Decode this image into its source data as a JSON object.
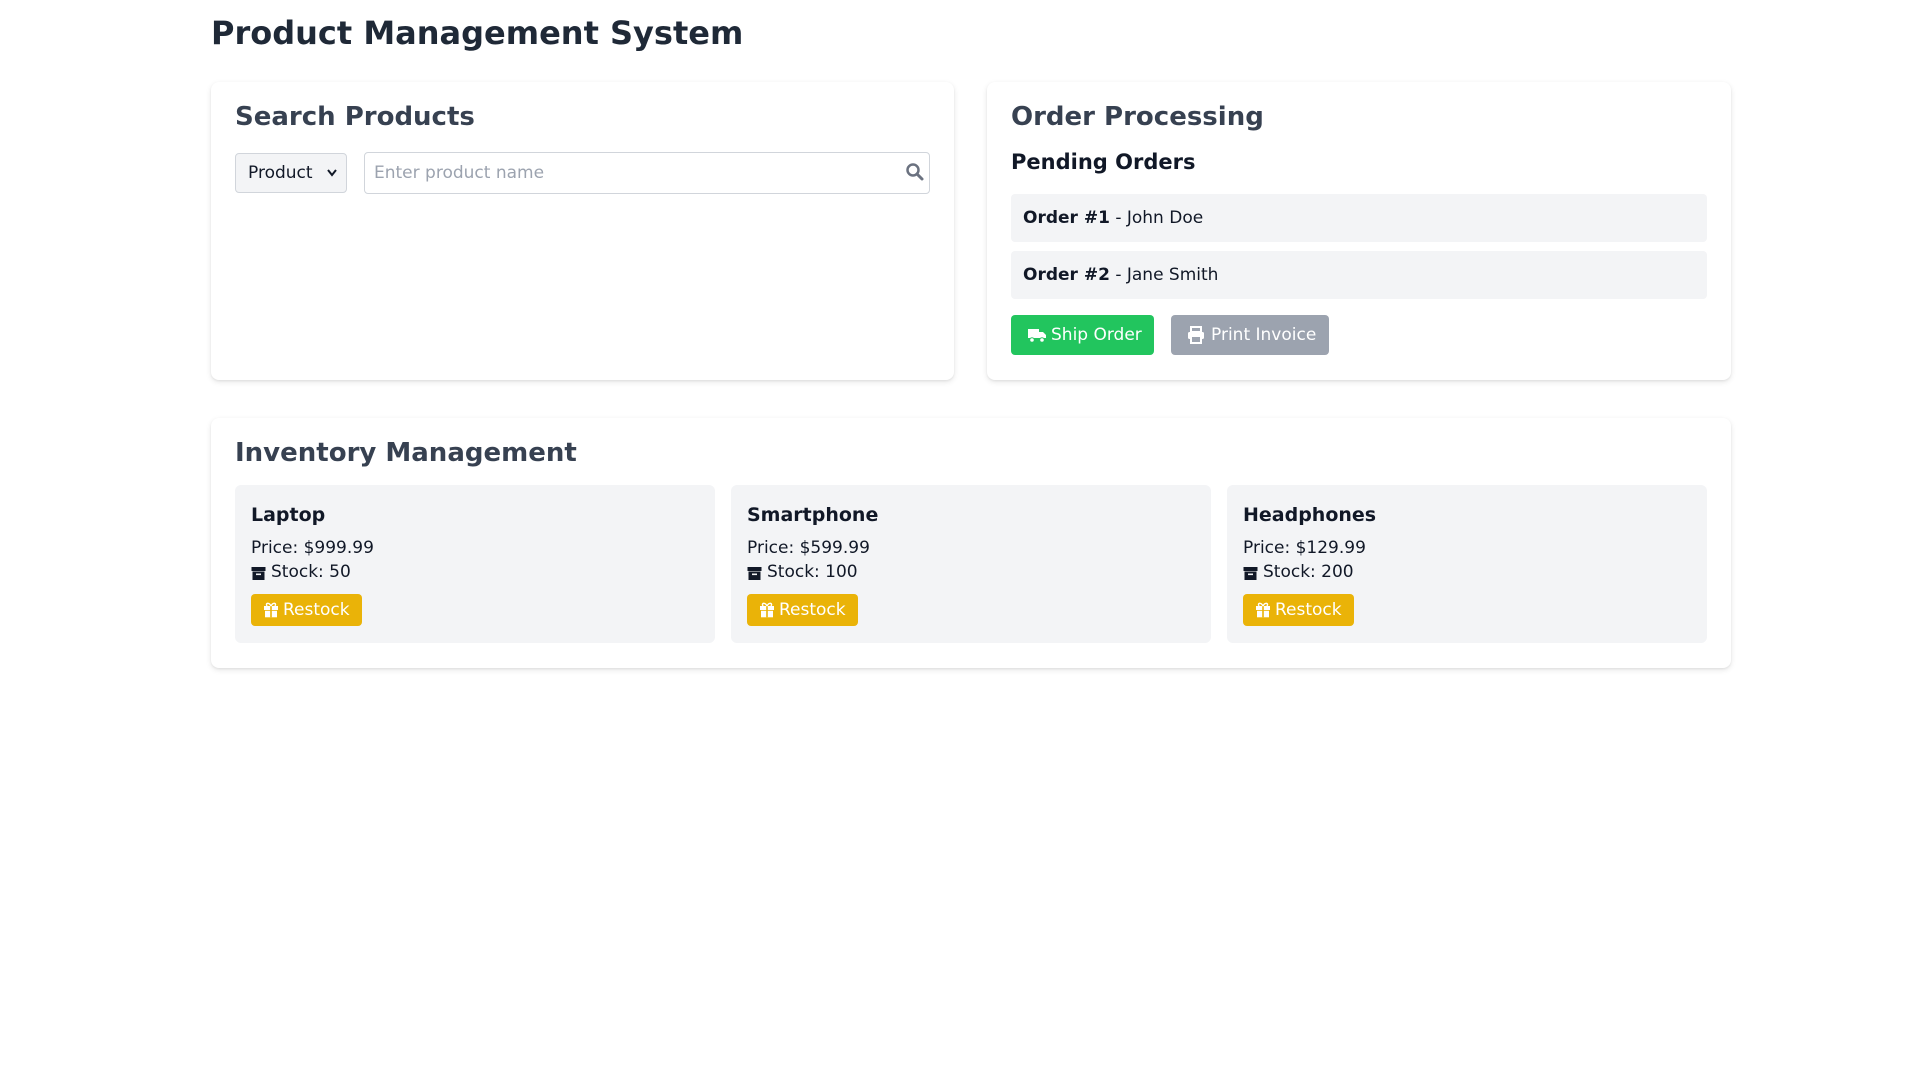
{
  "app": {
    "title": "Product Management System"
  },
  "search": {
    "heading": "Search Products",
    "select_value": "Product",
    "placeholder": "Enter product name",
    "icon": "search-icon"
  },
  "orders": {
    "heading": "Order Processing",
    "subheading": "Pending Orders",
    "items": [
      {
        "id": "Order #1",
        "customer": " - John Doe"
      },
      {
        "id": "Order #2",
        "customer": " - Jane Smith"
      }
    ],
    "ship_label": "Ship Order",
    "print_label": "Print Invoice"
  },
  "inventory": {
    "heading": "Inventory Management",
    "items": [
      {
        "name": "Laptop",
        "price": "Price: $999.99",
        "stock": "Stock: 50",
        "restock_label": "Restock"
      },
      {
        "name": "Smartphone",
        "price": "Price: $599.99",
        "stock": "Stock: 100",
        "restock_label": "Restock"
      },
      {
        "name": "Headphones",
        "price": "Price: $129.99",
        "stock": "Stock: 200",
        "restock_label": "Restock"
      }
    ]
  },
  "colors": {
    "ship_button": "#22c55e",
    "print_button": "#9ca3af",
    "restock_button": "#eab308",
    "card_bg": "#ffffff",
    "panel_bg": "#f3f4f6"
  }
}
